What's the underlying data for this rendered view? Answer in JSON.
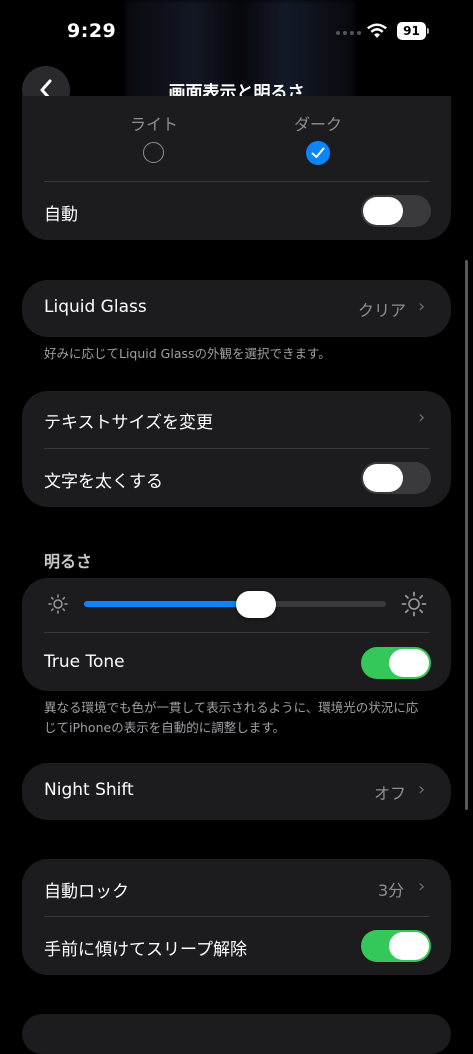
{
  "status_bar": {
    "time": "9:29",
    "battery": "91"
  },
  "nav": {
    "title": "画面表示と明るさ"
  },
  "appearance": {
    "light_label": "ライト",
    "dark_label": "ダーク",
    "selected": "dark",
    "automatic_label": "自動",
    "automatic_on": false
  },
  "liquid_glass": {
    "label": "Liquid Glass",
    "value": "クリア",
    "footnote": "好みに応じてLiquid Glassの外観を選択できます。"
  },
  "text": {
    "text_size_label": "テキストサイズを変更",
    "bold_text_label": "文字を太くする",
    "bold_text_on": false
  },
  "brightness": {
    "header": "明るさ",
    "level": 0.57,
    "true_tone_label": "True Tone",
    "true_tone_on": true,
    "footnote": "異なる環境でも色が一貫して表示されるように、環境光の状況に応じてiPhoneの表示を自動的に調整します。"
  },
  "night_shift": {
    "label": "Night Shift",
    "value": "オフ"
  },
  "lock": {
    "auto_lock_label": "自動ロック",
    "auto_lock_value": "3分",
    "raise_to_wake_label": "手前に傾けてスリープ解除",
    "raise_to_wake_on": true
  },
  "colors": {
    "accent": "#0a84ff",
    "toggle_on": "#34c759",
    "card": "#1c1c1e"
  }
}
